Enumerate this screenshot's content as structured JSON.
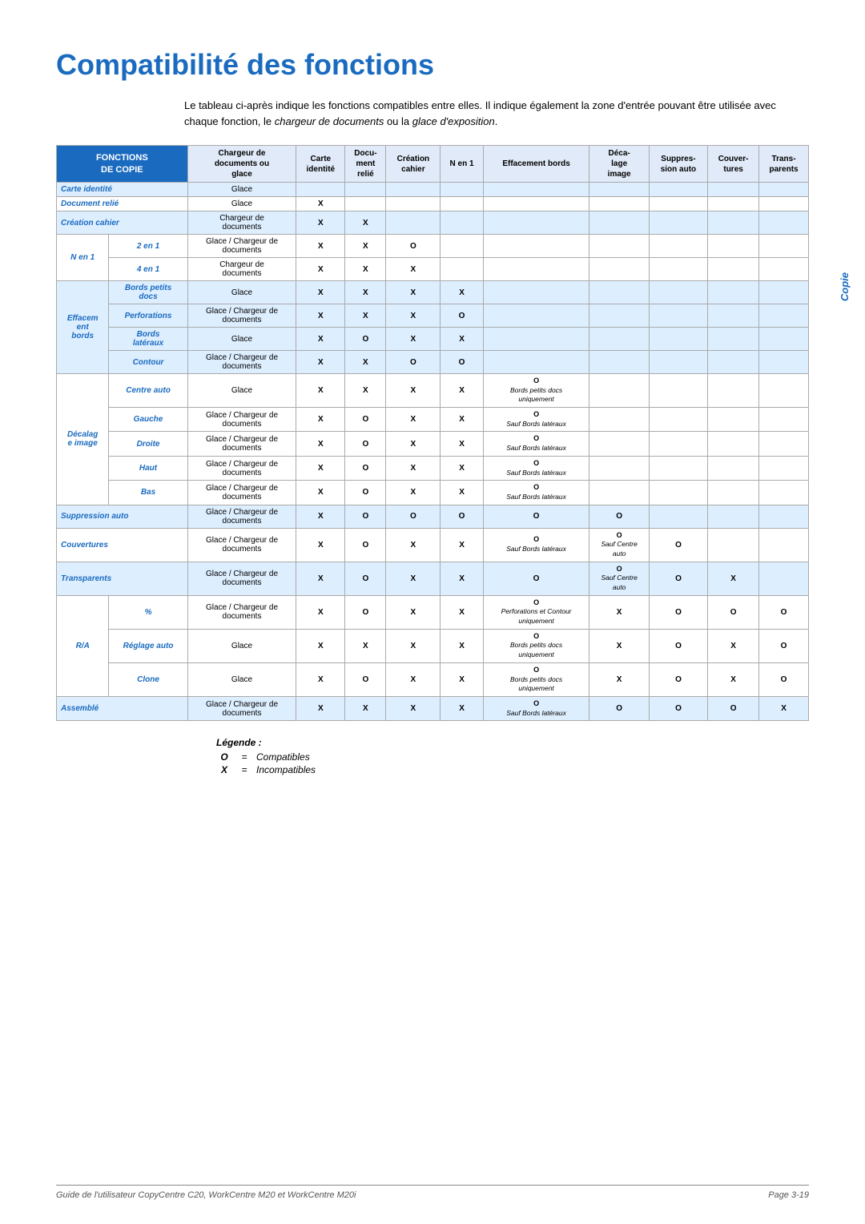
{
  "page": {
    "title": "Compatibilité des fonctions",
    "side_label": "Copie",
    "intro": "Le tableau ci-après indique les fonctions compatibles entre elles. Il indique également la zone d'entrée pouvant être utilisée avec chaque fonction, le ",
    "intro_em1": "chargeur de documents",
    "intro_mid": " ou la ",
    "intro_em2": "glace d'exposition",
    "intro_end": ".",
    "footer_left": "Guide de l'utilisateur CopyCentre C20, WorkCentre M20 et WorkCentre M20i",
    "footer_right": "Page 3-19"
  },
  "table": {
    "headers": {
      "fonctions_de_copie": "FONCTIONS DE COPIE",
      "chargeur": "Chargeur de documents ou glace",
      "carte_identite": "Carte identité",
      "document_relie": "Docu-ment relié",
      "creation_cahier": "Création cahier",
      "n_en_1": "N en 1",
      "effacement_bords": "Effacement bords",
      "decalage_image": "Déca-lage image",
      "suppression_auto": "Suppres-sion auto",
      "couvertures": "Couver-tures",
      "transparents": "Trans-parents"
    }
  },
  "legend": {
    "title": "Légende :",
    "o_label": "O",
    "o_meaning": "Compatibles",
    "x_label": "X",
    "x_meaning": "Incompatibles"
  }
}
